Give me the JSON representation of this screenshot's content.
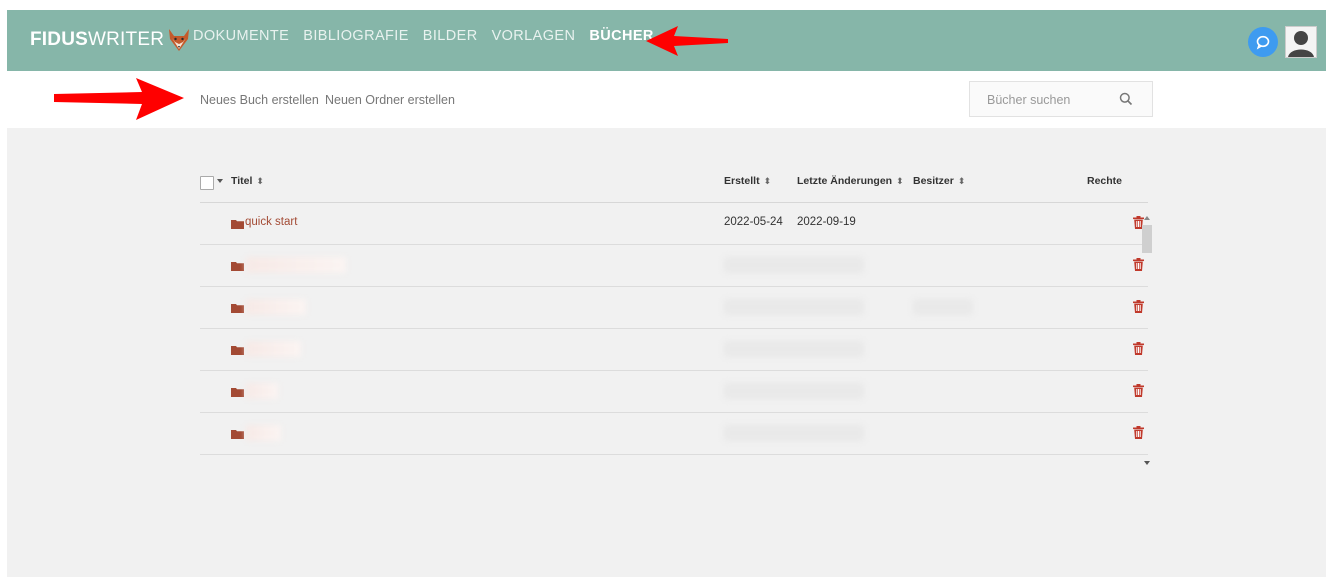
{
  "app": {
    "logo_bold": "FIDUS",
    "logo_thin": "WRITER"
  },
  "nav": {
    "items": [
      {
        "label": "DOKUMENTE"
      },
      {
        "label": "BIBLIOGRAFIE"
      },
      {
        "label": "BILDER"
      },
      {
        "label": "VORLAGEN"
      },
      {
        "label": "BÜCHER",
        "active": true
      }
    ]
  },
  "toolbar": {
    "new_book": "Neues Buch erstellen",
    "new_folder": "Neuen Ordner erstellen",
    "search_placeholder": "Bücher suchen"
  },
  "table": {
    "columns": {
      "title": "Titel",
      "created": "Erstellt",
      "modified": "Letzte Änderungen",
      "owner": "Besitzer",
      "rights": "Rechte"
    },
    "rows": [
      {
        "title": "quick start",
        "created": "2022-05-24",
        "modified": "2022-09-19",
        "owner": ""
      },
      {
        "title": "",
        "created": "",
        "modified": "",
        "owner": ""
      },
      {
        "title": "",
        "created": "",
        "modified": "",
        "owner": ""
      },
      {
        "title": "",
        "created": "",
        "modified": "",
        "owner": ""
      },
      {
        "title": "",
        "created": "",
        "modified": "",
        "owner": ""
      },
      {
        "title": "",
        "created": "",
        "modified": "",
        "owner": ""
      }
    ]
  },
  "colors": {
    "navbar": "#86b6a9",
    "link": "#a34a34",
    "trash": "#c0392b",
    "annotation_arrow": "#ff0000",
    "chat": "#3e9bf0"
  },
  "icons": [
    "fox-logo-icon",
    "chat-icon",
    "user-avatar-icon",
    "search-icon",
    "folder-icon",
    "trash-icon",
    "red-arrow-annotation"
  ]
}
